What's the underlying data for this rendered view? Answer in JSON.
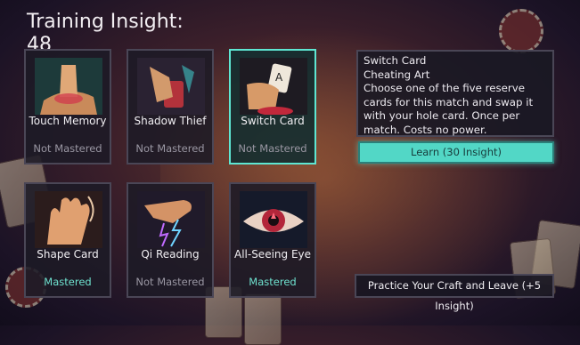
{
  "header": {
    "title": "Training Insight:",
    "insight_value": "48"
  },
  "cards": [
    {
      "name": "Touch Memory",
      "status": "Not Mastered",
      "mastered": false,
      "icon": "finger-touch-icon"
    },
    {
      "name": "Shadow Thief",
      "status": "Not Mastered",
      "mastered": false,
      "icon": "hand-holding-card-icon"
    },
    {
      "name": "Switch Card",
      "status": "Not Mastered",
      "mastered": false,
      "selected": true,
      "icon": "hand-switch-card-icon"
    },
    {
      "name": "Shape Card",
      "status": "Mastered",
      "mastered": true,
      "icon": "open-palm-icon"
    },
    {
      "name": "Qi Reading",
      "status": "Not Mastered",
      "mastered": false,
      "icon": "hand-lightning-icon"
    },
    {
      "name": "All-Seeing Eye",
      "status": "Mastered",
      "mastered": true,
      "icon": "eye-icon"
    }
  ],
  "detail": {
    "name": "Switch Card",
    "category": "Cheating Art",
    "description": "Choose one of the five reserve cards for this match and swap it with your hole card. Once per match. Costs no power."
  },
  "learn_button": "Learn (30 Insight)",
  "leave_button": "Practice Your Craft and Leave (+5 Insight)",
  "colors": {
    "accent": "#5ee6d2",
    "mastered": "#6fe3d0",
    "not_mastered": "#9a97a3"
  }
}
